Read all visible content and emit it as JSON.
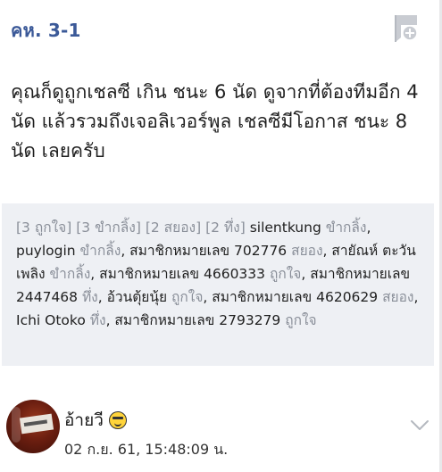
{
  "comment": {
    "number": "คห. 3-1",
    "body": "คุณก็ดูถูกเชลซี เกิน ชนะ 6 นัด ดูจากที่ต้องทีมอีก 4 นัด แล้วรวมถึงเจอลิเวอร์พูล เชลซีมีโอกาส ชนะ 8 นัด เลยครับ"
  },
  "reactions": {
    "summary": [
      "[3 ถูกใจ]",
      "[3 ขำกลิ้ง]",
      "[2 สยอง]",
      "[2 ทึ่ง]"
    ],
    "entries": [
      {
        "user": "silentkung",
        "reaction": "ขำกลิ้ง"
      },
      {
        "user": "puylogin",
        "reaction": "ขำกลิ้ง"
      },
      {
        "user": "สมาชิกหมายเลข 702776",
        "reaction": "สยอง"
      },
      {
        "user": "สายัณห์ ตะวันเพลิง",
        "reaction": "ขำกลิ้ง"
      },
      {
        "user": "สมาชิกหมายเลข 4660333",
        "reaction": "ถูกใจ"
      },
      {
        "user": "สมาชิกหมายเลข 2447468",
        "reaction": "ทึ่ง"
      },
      {
        "user": "อ้วนตุ้ยนุ้ย",
        "reaction": "ถูกใจ"
      },
      {
        "user": "สมาชิกหมายเลข 4620629",
        "reaction": "สยอง"
      },
      {
        "user": "Ichi Otoko",
        "reaction": "ทึ่ง"
      },
      {
        "user": "สมาชิกหมายเลข 2793279",
        "reaction": "ถูกใจ"
      }
    ]
  },
  "author": {
    "name": "อ้ายวี",
    "emoji": "grinning-face-emoji",
    "timestamp": "02 ก.ย. 61, 15:48:09 น."
  },
  "icons": {
    "bookmark": "bookmark-add-icon",
    "expand": "chevron-down-icon"
  },
  "colors": {
    "comment_number": "#3b5998",
    "reaction_box": "#eef0f4",
    "muted_text": "#8a8f99"
  }
}
